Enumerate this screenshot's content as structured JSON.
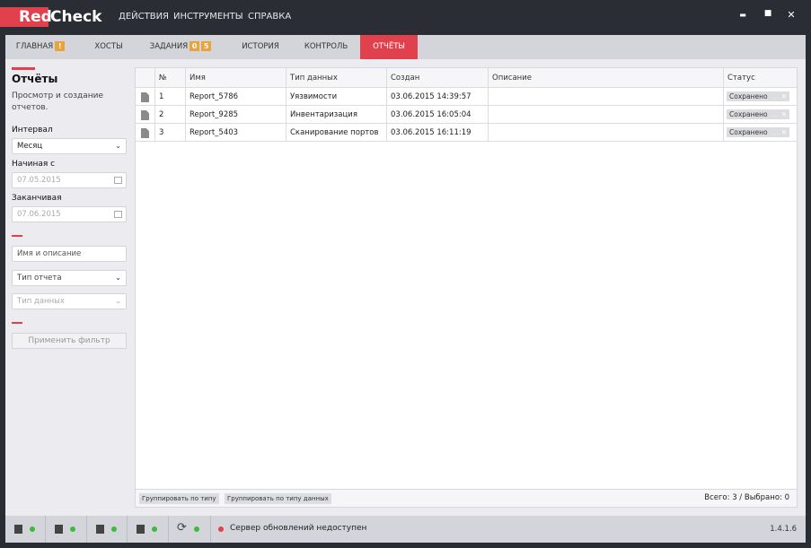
{
  "app": {
    "logo_red": "Red",
    "logo_white": "Check",
    "brand_color": "#e1414c"
  },
  "menu": [
    "ДЕЙСТВИЯ",
    "ИНСТРУМЕНТЫ",
    "СПРАВКА"
  ],
  "window": {
    "minimize": "▬",
    "maximize": "■",
    "close": "✕"
  },
  "tabs": [
    {
      "label": "ГЛАВНАЯ",
      "badges": [
        "!"
      ]
    },
    {
      "label": "ХОСТЫ",
      "badges": []
    },
    {
      "label": "ЗАДАНИЯ",
      "badges": [
        "0",
        "5"
      ]
    },
    {
      "label": "ИСТОРИЯ",
      "badges": []
    },
    {
      "label": "КОНТРОЛЬ",
      "badges": []
    },
    {
      "label": "ОТЧЁТЫ",
      "badges": [],
      "active": true
    }
  ],
  "sidebar": {
    "title": "Отчёты",
    "description": "Просмотр и создание отчетов.",
    "interval_label": "Интервал",
    "interval_value": "Месяц",
    "start_label": "Начиная с",
    "start_value": "07.05.2015",
    "end_label": "Заканчивая",
    "end_value": "07.06.2015",
    "name_placeholder": "Имя и описание",
    "report_type": "Тип отчета",
    "data_type": "Тип данных",
    "apply": "Применить фильтр"
  },
  "table": {
    "columns": [
      "№",
      "Имя",
      "Тип данных",
      "Создан",
      "Описание",
      "Статус"
    ],
    "rows": [
      {
        "no": "1",
        "name": "Report_5786",
        "type": "Уязвимости",
        "created": "03.06.2015 14:39:57",
        "description": "",
        "status": "Сохранено"
      },
      {
        "no": "2",
        "name": "Report_9285",
        "type": "Инвентаризация",
        "created": "03.06.2015 16:05:04",
        "description": "",
        "status": "Сохранено"
      },
      {
        "no": "3",
        "name": "Report_5403",
        "type": "Сканирование портов",
        "created": "03.06.2015 16:11:19",
        "description": "",
        "status": "Сохранено"
      }
    ],
    "group_by_type": "Группировать по типу",
    "group_by_data_type": "Группировать по типу данных",
    "summary": "Всего: 3 / Выбрано: 0"
  },
  "statusbar": {
    "message": "Сервер обновлений недоступен",
    "version": "1.4.1.6"
  }
}
